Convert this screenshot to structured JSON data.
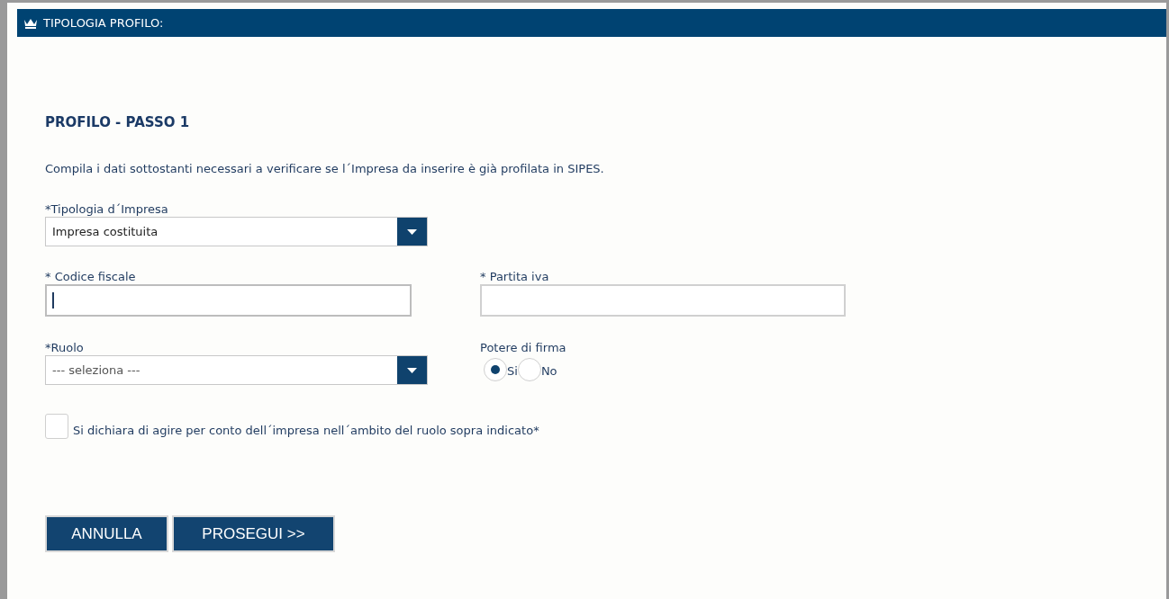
{
  "header": {
    "title": "TIPOLOGIA PROFILO:"
  },
  "heading": "PROFILO - PASSO 1",
  "description": "Compila i dati sottostanti necessari a verificare se l´Impresa da inserire è già profilata in SIPES.",
  "tipologia": {
    "label": "*Tipologia d´Impresa",
    "value": "Impresa costituita"
  },
  "codice_fiscale": {
    "label": "* Codice fiscale",
    "focused": true
  },
  "partita_iva": {
    "label": "* Partita iva",
    "focused": false
  },
  "ruolo": {
    "label": "*Ruolo",
    "placeholder": "--- seleziona ---"
  },
  "potere_di_firma": {
    "label": "Potere di firma",
    "options": [
      {
        "label": "Si",
        "selected": true
      },
      {
        "label": "No",
        "selected": false
      }
    ]
  },
  "declaration": {
    "label": "Si dichiara di agire per conto dell´impresa nell´ambito del ruolo sopra indicato*",
    "checked": false
  },
  "buttons": [
    "ANNULLA",
    "PROSEGUI >>"
  ]
}
